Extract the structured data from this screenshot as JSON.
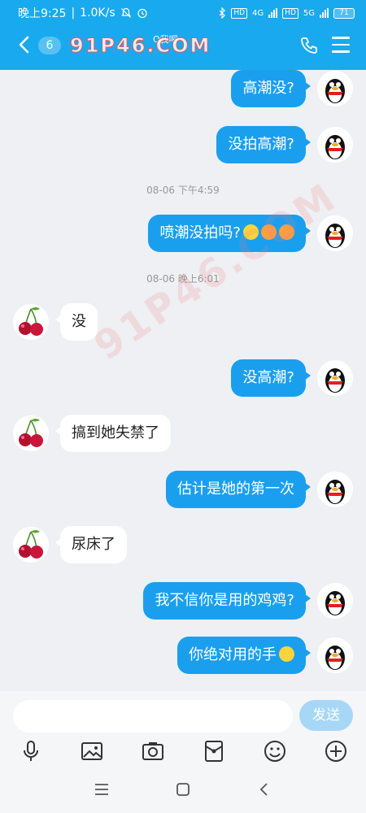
{
  "status_bar": {
    "time": "晚上9:25",
    "speed": "1.0K/s",
    "battery": "71",
    "network_1": "4G",
    "network_2": "5G",
    "hd": "HD"
  },
  "header": {
    "back_badge": "6",
    "title": "",
    "subtitle": "Q我吧 ›",
    "watermark": "91P46.COM"
  },
  "messages": [
    {
      "side": "out",
      "text": "高潮没?"
    },
    {
      "side": "out",
      "text": "没拍高潮?"
    },
    {
      "type": "time",
      "text": "08-06 下午4:59"
    },
    {
      "side": "out",
      "text": "喷潮没拍吗?",
      "emojis": 3
    },
    {
      "type": "time",
      "text": "08-06 晚上6:01"
    },
    {
      "side": "in",
      "text": "没"
    },
    {
      "side": "out",
      "text": "没高潮?"
    },
    {
      "side": "in",
      "text": "搞到她失禁了"
    },
    {
      "side": "out",
      "text": "估计是她的第一次"
    },
    {
      "side": "in",
      "text": "尿床了"
    },
    {
      "side": "out",
      "text": "我不信你是用的鸡鸡?"
    },
    {
      "side": "out",
      "text": "你绝对用的手",
      "emojis": 1
    }
  ],
  "composer": {
    "input_value": "",
    "send_label": "发送"
  },
  "toolbar": [
    "microphone-icon",
    "image-icon",
    "camera-icon",
    "red-packet-icon",
    "emoji-icon",
    "plus-icon"
  ],
  "colors": {
    "brand_blue": "#19a9ee",
    "outgoing_bubble": "#1a9fef",
    "send_button": "#a7d7f6"
  }
}
